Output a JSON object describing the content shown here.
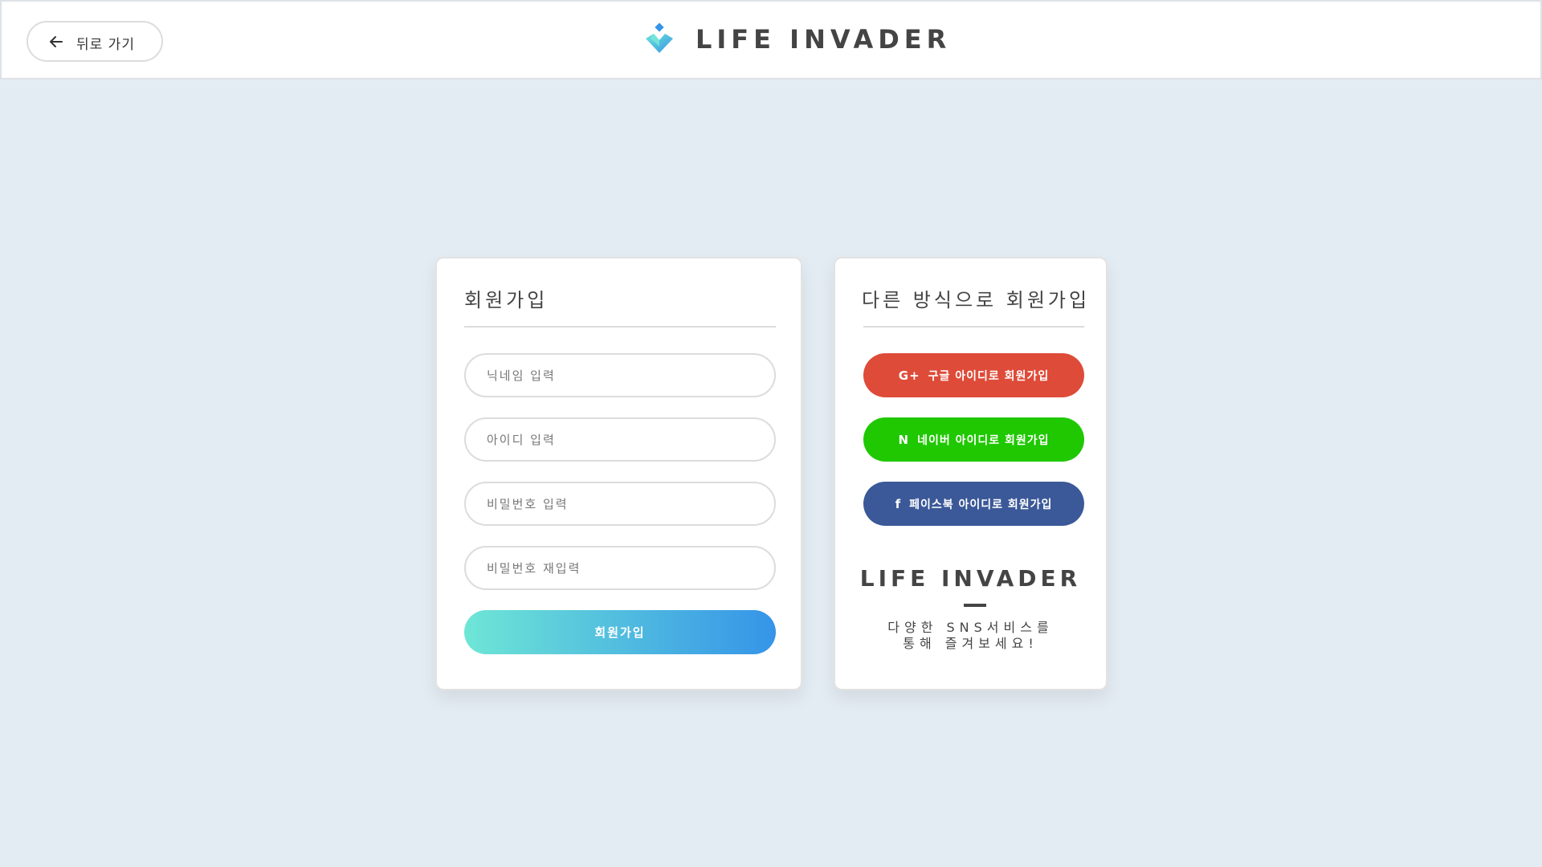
{
  "header": {
    "back_label": "뒤로 가기",
    "brand_name": "LIFE INVADER"
  },
  "signup": {
    "title": "회원가입",
    "fields": [
      {
        "placeholder": "닉네임 입력"
      },
      {
        "placeholder": "아이디 입력"
      },
      {
        "placeholder": "비밀번호 입력"
      },
      {
        "placeholder": "비밀번호 재입력"
      }
    ],
    "submit_label": "회원가입"
  },
  "alt_signup": {
    "title": "다른 방식으로 회원가입",
    "buttons": [
      {
        "icon": "G+",
        "label": "구글 아이디로 회원가입",
        "color": "#de4b39"
      },
      {
        "icon": "N",
        "label": "네이버 아이디로 회원가입",
        "color": "#1fc800"
      },
      {
        "icon": "f",
        "label": "페이스북 아이디로 회원가입",
        "color": "#3b5998"
      }
    ],
    "promo_name": "LIFE INVADER",
    "promo_line1": "다양한 SNS서비스를",
    "promo_line2": "통해 즐겨보세요!"
  }
}
